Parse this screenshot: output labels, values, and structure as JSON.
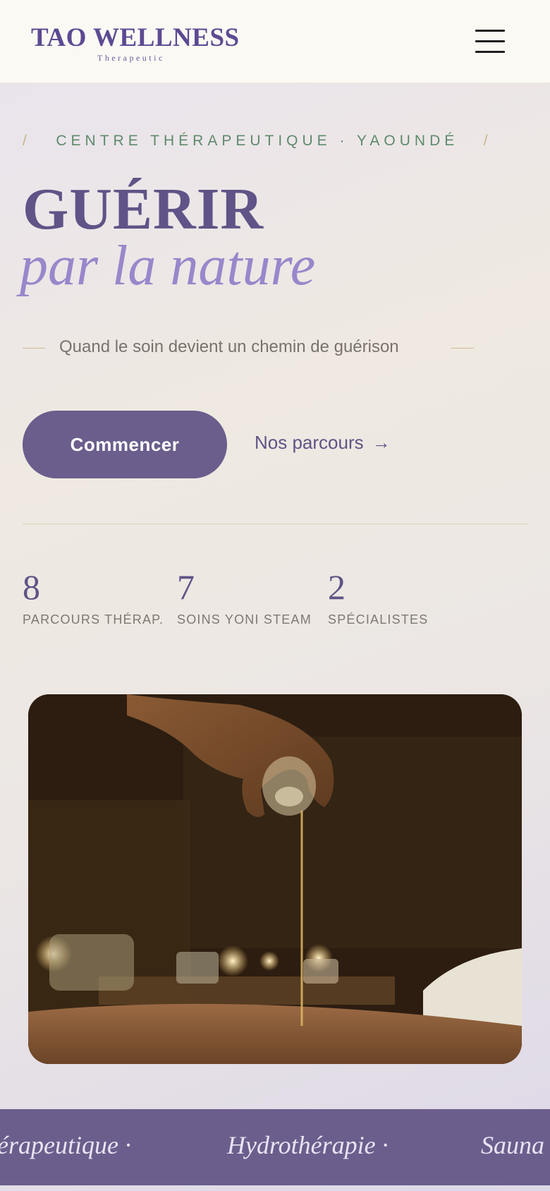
{
  "header": {
    "logo_title": "TAO WELLNESS",
    "logo_subtitle": "Therapeutic",
    "menu_icon": "hamburger-menu-icon"
  },
  "hero": {
    "eyebrow_slash": "/",
    "eyebrow": "CENTRE THÉRAPEUTIQUE · YAOUNDÉ",
    "title": "GUÉRIR",
    "title_italic": "par la nature",
    "tagline": "Quand le soin devient un chemin de guérison",
    "cta_primary": "Commencer",
    "cta_secondary": "Nos parcours",
    "cta_secondary_arrow": "→"
  },
  "stats": [
    {
      "value": "8",
      "label": "PARCOURS THÉRAP."
    },
    {
      "value": "7",
      "label": "SOINS YONI STEAM"
    },
    {
      "value": "2",
      "label": "SPÉCIALISTES"
    }
  ],
  "banner": {
    "items": [
      "érapeutique ·",
      "Hydrothérapie ·",
      "Sauna"
    ]
  },
  "colors": {
    "accent": "#6b5e8c",
    "brand": "#5d4a93",
    "eyebrow": "#5e8a6c",
    "italic": "#9a86cb"
  }
}
